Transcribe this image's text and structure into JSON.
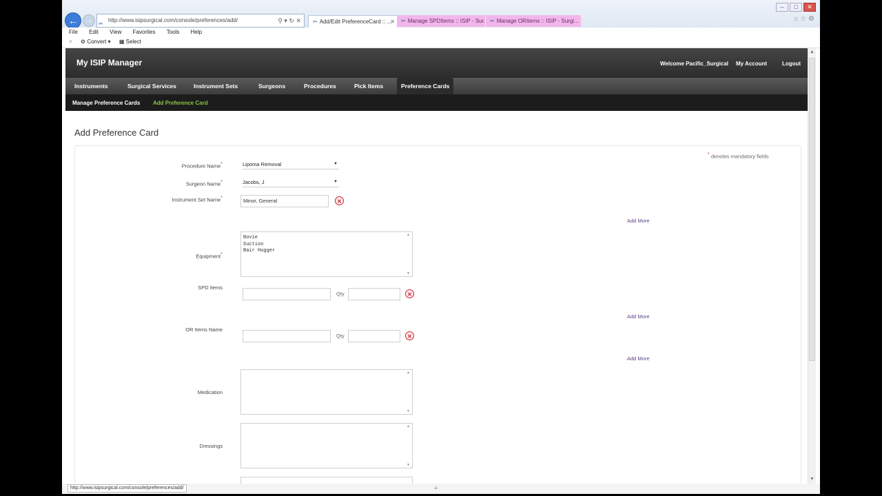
{
  "browser": {
    "address_url": "http://www.isipsurgical.com/console/preferences/add/",
    "tabs": [
      {
        "label": "Add/Edit PreferenceCard :: ..."
      },
      {
        "label": "Manage SPDItems :: ISIP - Sur..."
      },
      {
        "label": "Manage ORItems :: ISIP - Surgi..."
      }
    ],
    "menu": [
      "File",
      "Edit",
      "View",
      "Favorites",
      "Tools",
      "Help"
    ],
    "cmd_convert": "Convert",
    "cmd_select": "Select",
    "status_url": "http://www.isipsurgical.com/console/preferences/add/"
  },
  "header": {
    "logo": "My ISIP Manager",
    "welcome": "Welcome Pacific_Surgical",
    "my_account": "My Account",
    "logout": "Logout"
  },
  "nav": {
    "items": [
      "Instruments",
      "Surgical Services",
      "Instrument Sets",
      "Surgeons",
      "Procedures",
      "Pick Items",
      "Preference Cards"
    ],
    "active": "Preference Cards"
  },
  "subnav": {
    "manage": "Manage Preference Cards",
    "add": "Add Preference Card"
  },
  "page": {
    "title": "Add Preference Card",
    "mandatory_note": "denotes mandatory fields"
  },
  "form": {
    "procedure_label": "Procedure Name",
    "procedure_value": "Lipoma Removal",
    "surgeon_label": "Surgeon Name",
    "surgeon_value": "Jacobs, J",
    "instrument_set_label": "Instrument Set Name",
    "instrument_set_value": "Minor, General",
    "add_more": "Add More",
    "equipment_label": "Equipment",
    "equipment_lines": [
      "Bovie",
      "Suction",
      "Bair Hugger"
    ],
    "spd_label": "SPD Items",
    "qty_label": "Qty",
    "or_label": "OR Items Name",
    "medication_label": "Medication",
    "dressings_label": "Dressings"
  },
  "colors": {
    "header_bg": "#252525",
    "subnav_active": "#8cc63f",
    "link_purple": "#5a3e8a",
    "tab_pink": "#f2b7ea"
  }
}
